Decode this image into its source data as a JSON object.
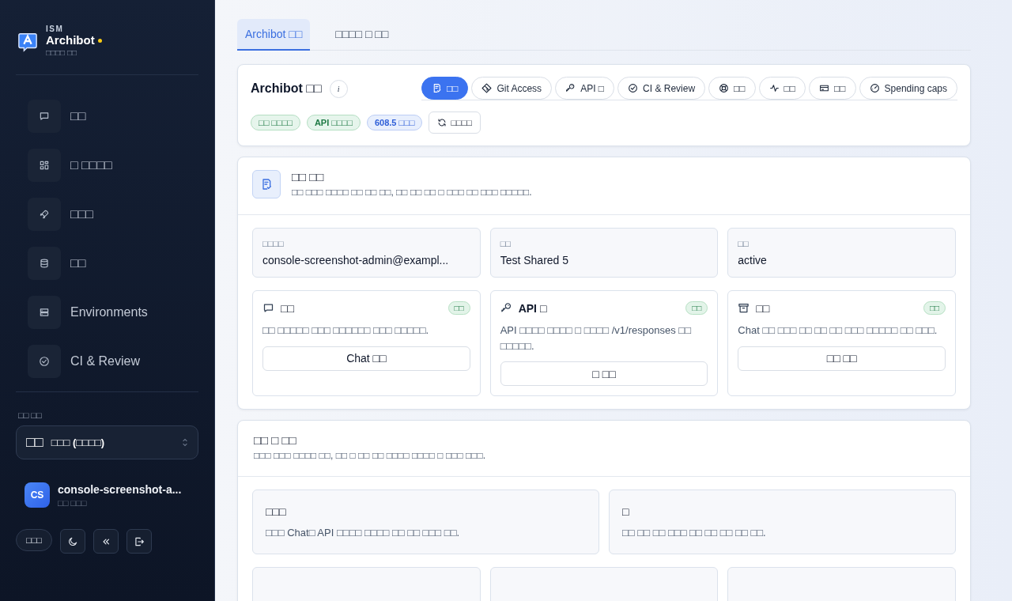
{
  "brand": {
    "overline": "ISM",
    "name": "Archibot",
    "subtitle": "□□□□ □□"
  },
  "nav": [
    {
      "label": "□□",
      "selected": false
    },
    {
      "label": "□ □□□□",
      "selected": false
    },
    {
      "label": "□□□",
      "selected": false
    },
    {
      "label": "□□",
      "selected": false
    },
    {
      "label": "Environments",
      "selected": false
    },
    {
      "label": "CI & Review",
      "selected": false
    }
  ],
  "workspace": {
    "label": "□□ □□",
    "prefix": "□□",
    "value": "□□□ (□□□□)"
  },
  "user": {
    "initials": "CS",
    "name": "console-screenshot-a...",
    "role": "□□ □□□"
  },
  "footer": {
    "language": "□□□"
  },
  "tabs": [
    {
      "label": "Archibot □□",
      "selected": true
    },
    {
      "label": "□□□□ □ □□",
      "selected": false
    }
  ],
  "header": {
    "title": "Archibot □□",
    "info": "i",
    "toolbar": [
      {
        "label": "□□",
        "selected": true
      },
      {
        "label": "Git Access",
        "selected": false
      },
      {
        "label": "API □",
        "selected": false
      },
      {
        "label": "CI & Review",
        "selected": false
      },
      {
        "label": "□□",
        "selected": false
      },
      {
        "label": "□□",
        "selected": false
      },
      {
        "label": "□□",
        "selected": false
      },
      {
        "label": "Spending caps",
        "selected": false
      }
    ],
    "badges": [
      {
        "label": "□□ □□□□",
        "kind": "success"
      },
      {
        "label": "API □□□□",
        "kind": "success"
      },
      {
        "label": "608.5 □□□",
        "kind": "info"
      }
    ],
    "refresh": "□□□□"
  },
  "access": {
    "title": "□□ □□",
    "description": "□□ □□□ □□□□ □□ □□ □□, □□ □□ □□ □ □□□ □□ □□□ □□□□□.",
    "fields": [
      {
        "label": "□□□□",
        "value": "console-screenshot-admin@exampl..."
      },
      {
        "label": "□□",
        "value": "Test Shared 5"
      },
      {
        "label": "□□",
        "value": "active"
      }
    ],
    "features": [
      {
        "title": "□□",
        "status": "□□",
        "description": "□□ □□□□□ □□□ □□□□□□ □□□ □□□□□.",
        "button": "Chat □□"
      },
      {
        "title": "API □",
        "status": "□□",
        "description": "API □□□□ □□□□ □ □□□□ /v1/responses □□ □□□□□.",
        "button": "□ □□"
      },
      {
        "title": "□□",
        "status": "□□",
        "description": "Chat □□ □□□ □□ □□ □□ □□□ □□□□□ □□ □□□.",
        "button": "□□ □□"
      }
    ]
  },
  "usage": {
    "title": "□□ □ □□",
    "description": "□□□ □□□ □□□□ □□, □□ □ □□ □□ □□□□ □□□□ □ □□□ □□□.",
    "tiles": [
      {
        "title": "□□□",
        "description": "□□□ Chat□ API □□□□ □□□□ □□ □□ □□□ □□."
      },
      {
        "title": "□",
        "description": "□□ □□ □□ □□□ □□ □□ □□ □□ □□."
      }
    ]
  }
}
